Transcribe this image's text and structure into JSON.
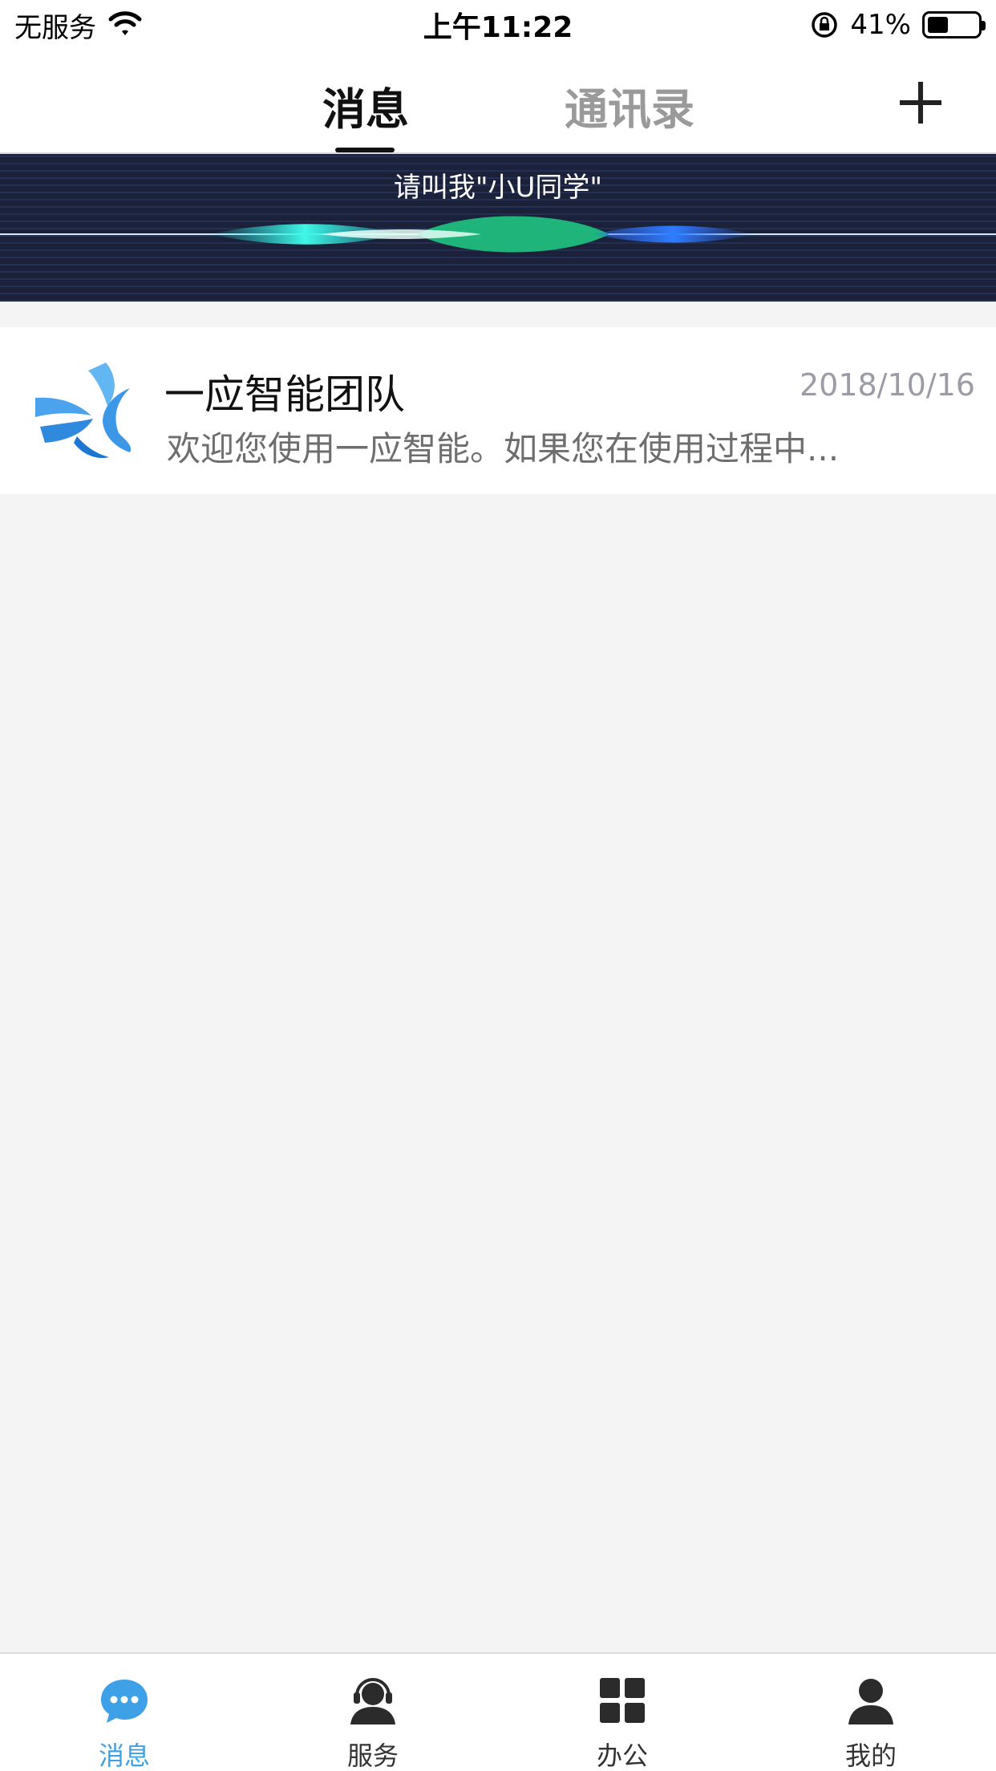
{
  "status_bar": {
    "carrier": "无服务",
    "time": "上午11:22",
    "battery_percent": "41%",
    "battery_level": 0.41
  },
  "header": {
    "tabs": [
      {
        "label": "消息",
        "active": true
      },
      {
        "label": "通讯录",
        "active": false
      }
    ],
    "add_icon": "plus-icon"
  },
  "voice_banner": {
    "prompt": "请叫我\"小U同学\""
  },
  "messages": [
    {
      "name": "一应智能团队",
      "time": "2018/10/16",
      "preview": "欢迎您使用一应智能。如果您在使用过程中...",
      "avatar_icon": "yiying-logo-icon"
    }
  ],
  "tab_bar": {
    "items": [
      {
        "label": "消息",
        "icon": "chat-bubble-icon",
        "active": true
      },
      {
        "label": "服务",
        "icon": "headset-icon",
        "active": false
      },
      {
        "label": "办公",
        "icon": "grid-icon",
        "active": false
      },
      {
        "label": "我的",
        "icon": "person-icon",
        "active": false
      }
    ]
  },
  "colors": {
    "accent": "#3ea0e6",
    "banner_bg": "#1b2138",
    "page_bg": "#f4f4f4"
  }
}
